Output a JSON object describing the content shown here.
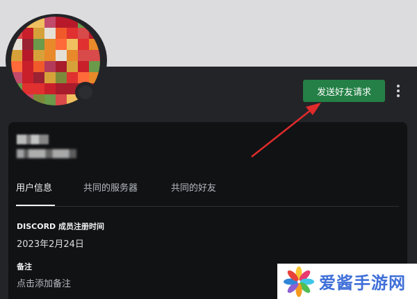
{
  "profile": {
    "add_friend_label": "发送好友请求",
    "more_icon": "more-vertical-icon",
    "accent_color": "#248046"
  },
  "tabs": [
    {
      "label": "用户信息",
      "active": true
    },
    {
      "label": "共同的服务器",
      "active": false
    },
    {
      "label": "共同的好友",
      "active": false
    }
  ],
  "info": {
    "member_since_title": "DISCORD 成员注册时间",
    "member_since_value": "2023年2月24日",
    "note_title": "备注",
    "note_placeholder": "点击添加备注"
  },
  "watermark": {
    "text": "爱酱手游网"
  }
}
